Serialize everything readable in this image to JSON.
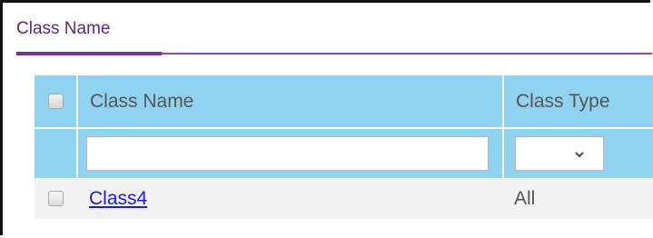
{
  "section": {
    "title": "Class Name"
  },
  "table": {
    "columns": [
      {
        "label": "Class Name"
      },
      {
        "label": "Class Type"
      }
    ],
    "filter": {
      "name_value": "",
      "type_selected": ""
    },
    "rows": [
      {
        "name": "Class4",
        "type": "All"
      }
    ]
  },
  "colors": {
    "accent": "#7b2f9e",
    "header_bg": "#8fd3f1",
    "row_bg": "#f2f2f2",
    "link": "#1a1aee"
  },
  "icons": {
    "select_arrow": "chevron-down-icon",
    "checkbox": "checkbox"
  }
}
